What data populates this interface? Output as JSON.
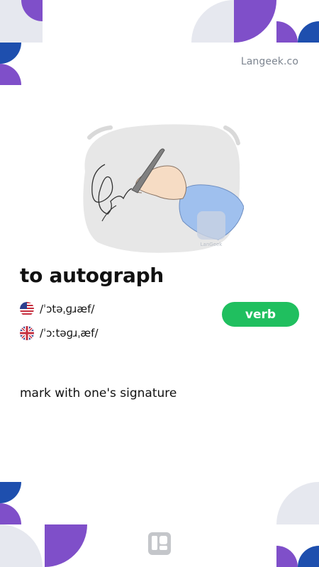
{
  "brand": {
    "name": "Langeek.co"
  },
  "entry": {
    "word": "to autograph",
    "part_of_speech": "verb",
    "pronunciations": [
      {
        "region": "US",
        "icon": "us-flag-icon",
        "ipa": "/ˈɔtəˌɡɹæf/"
      },
      {
        "region": "UK",
        "icon": "uk-flag-icon",
        "ipa": "/ˈɔːtəɡɹˌæf/"
      }
    ],
    "definition": "mark with one's signature"
  },
  "colors": {
    "purple": "#7f4fc9",
    "blue": "#1e4fae",
    "light_gray": "#e6e8ef",
    "badge_green": "#20bf5f"
  }
}
